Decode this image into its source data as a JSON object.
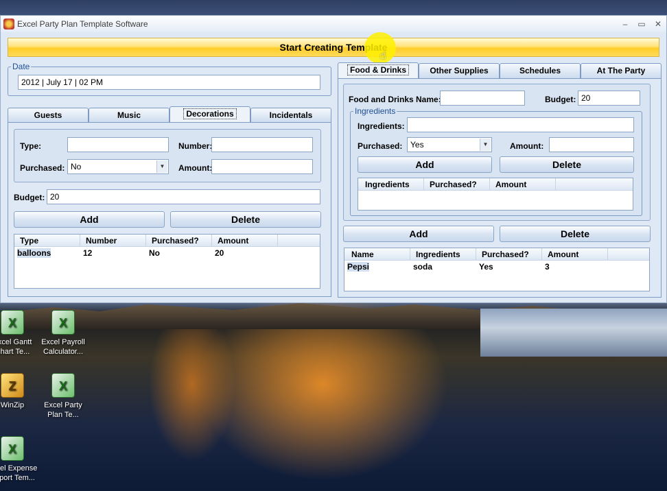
{
  "desktop": {
    "icons": [
      {
        "label": "Excel Gantt Chart Te...",
        "icon": "excel-gantt-icon"
      },
      {
        "label": "Excel Payroll Calculator...",
        "icon": "excel-payroll-icon"
      },
      {
        "label": "WinZip",
        "icon": "winzip-icon"
      },
      {
        "label": "Excel Party Plan Te...",
        "icon": "excel-party-icon"
      },
      {
        "label": "Excel Expense Report Tem...",
        "icon": "excel-expense-icon"
      }
    ]
  },
  "window": {
    "title": "Excel Party Plan Template Software",
    "controls": {
      "minimize": "–",
      "maximize": "▭",
      "close": "✕"
    }
  },
  "start_button": "Start Creating Template",
  "date": {
    "legend": "Date",
    "value": "2012 | July 17 | 02 PM"
  },
  "left_tabs": [
    "Guests",
    "Music",
    "Decorations",
    "Incidentals"
  ],
  "left_active_tab": "Decorations",
  "decorations": {
    "type_label": "Type:",
    "type_value": "",
    "number_label": "Number:",
    "number_value": "",
    "purchased_label": "Purchased:",
    "purchased_value": "No",
    "amount_label": "Amount:",
    "amount_value": "",
    "budget_label": "Budget:",
    "budget_value": "20",
    "add_label": "Add",
    "delete_label": "Delete",
    "columns": [
      "Type",
      "Number",
      "Purchased?",
      "Amount"
    ],
    "rows": [
      [
        "balloons",
        "12",
        "No",
        "20"
      ]
    ]
  },
  "right_tabs": [
    "Food & Drinks",
    "Other Supplies",
    "Schedules",
    "At The Party"
  ],
  "right_active_tab": "Food & Drinks",
  "food": {
    "name_label": "Food and Drinks Name:",
    "name_value": "",
    "budget_label": "Budget:",
    "budget_value": "20",
    "ingredients_legend": "Ingredients",
    "ingredients_label": "Ingredients:",
    "ingredients_value": "",
    "purchased_label": "Purchased:",
    "purchased_value": "Yes",
    "amount_label": "Amount:",
    "amount_value": "",
    "ing_add_label": "Add",
    "ing_delete_label": "Delete",
    "ing_columns": [
      "Ingredients",
      "Purchased?",
      "Amount"
    ],
    "add_label": "Add",
    "delete_label": "Delete",
    "columns": [
      "Name",
      "Ingredients",
      "Purchased?",
      "Amount"
    ],
    "rows": [
      [
        "Pepsi",
        "soda",
        "Yes",
        "3"
      ]
    ]
  }
}
